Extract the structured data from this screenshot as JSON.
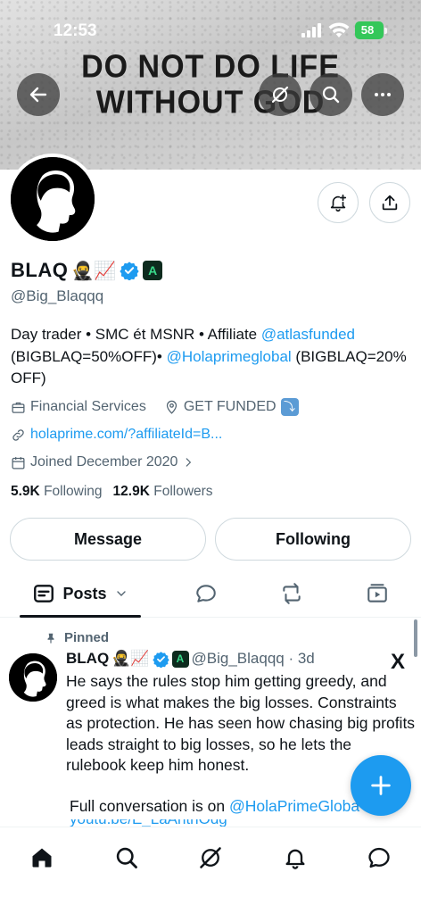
{
  "status_bar": {
    "time": "12:53",
    "battery": "58"
  },
  "banner": {
    "line1": "DO NOT DO LIFE",
    "line2": "WITHOUT GOD"
  },
  "profile": {
    "name": "BLAQ",
    "name_emojis": "🥷📈",
    "badge_letter": "A",
    "handle": "@Big_Blaqqq",
    "bio": {
      "part1": "Day trader • SMC ét MSNR • Affiliate ",
      "mention1": "@atlasfunded",
      "part2": " (BIGBLAQ=50%OFF)• ",
      "mention2": "@Holaprimeglobal",
      "part3": " (BIGBLAQ=20% OFF)"
    },
    "category": "Financial Services",
    "location": "GET FUNDED",
    "location_emoji": "⤵",
    "website": "holaprime.com/?affiliateId=B...",
    "joined": "Joined December 2020",
    "following_count": "5.9K",
    "following_label": "Following",
    "followers_count": "12.9K",
    "followers_label": "Followers"
  },
  "buttons": {
    "message": "Message",
    "following": "Following"
  },
  "tabs": {
    "posts": "Posts"
  },
  "pinned_post": {
    "pinned_label": "Pinned",
    "author_name": "BLAQ",
    "author_emojis": "🥷📈",
    "badge_letter": "A",
    "handle_time": "@Big_Blaqqq · 3d",
    "platform_mark": "X",
    "text": "He says the rules stop him getting greedy, and greed is what makes the big losses. Constraints as protection. He has seen how chasing big profits leads straight to big losses, so he lets the rulebook keep him honest.",
    "text2_prefix": "Full conversation is on ",
    "text2_mention": "@HolaPrimeGloba",
    "text3": "youtu.be/E_LaAntnOdg"
  },
  "colors": {
    "accent": "#1d9bf0",
    "text": "#0f1419",
    "secondary": "#536471"
  },
  "icons": {
    "back": "arrow-left-icon",
    "grok": "grok-icon",
    "search": "search-icon",
    "more": "more-icon",
    "notify": "bell-plus-icon",
    "share": "share-icon",
    "fab": "plus-icon",
    "nav": [
      "home-icon",
      "search-icon",
      "grok-icon",
      "bell-icon",
      "messages-icon"
    ]
  }
}
